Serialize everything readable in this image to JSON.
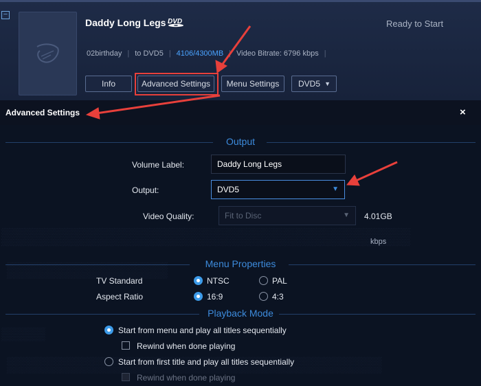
{
  "item": {
    "title": "Daddy Long Legs",
    "badge": "DVD",
    "status": "Ready to Start",
    "meta": {
      "source": "02birthday",
      "target": "to DVD5",
      "size": "4106/4300MB",
      "bitrate": "Video Bitrate: 6796 kbps"
    },
    "buttons": {
      "info": "Info",
      "advanced": "Advanced Settings",
      "menu": "Menu Settings",
      "disc": "DVD5"
    },
    "collapse_glyph": "−"
  },
  "dialog": {
    "title": "Advanced Settings",
    "close": "×",
    "output": {
      "heading": "Output",
      "volume_label": "Volume Label:",
      "volume_value": "Daddy Long Legs",
      "output_label": "Output:",
      "output_value": "DVD5",
      "quality_label": "Video Quality:",
      "quality_value": "Fit to Disc",
      "size": "4.01GB",
      "unit": "kbps"
    },
    "menu": {
      "heading": "Menu Properties",
      "tv_label": "TV Standard",
      "tv_options": [
        "NTSC",
        "PAL"
      ],
      "aspect_label": "Aspect Ratio",
      "aspect_options": [
        "16:9",
        "4:3"
      ]
    },
    "playback": {
      "heading": "Playback Mode",
      "option1": "Start from menu and play all titles sequentially",
      "rewind1": "Rewind when done playing",
      "option2": "Start from first title and play all titles sequentially",
      "rewind2": "Rewind when done playing"
    }
  },
  "colors": {
    "accent": "#3d8bdc",
    "highlight_red": "#e8403b",
    "size_blue": "#4aa3ff"
  }
}
